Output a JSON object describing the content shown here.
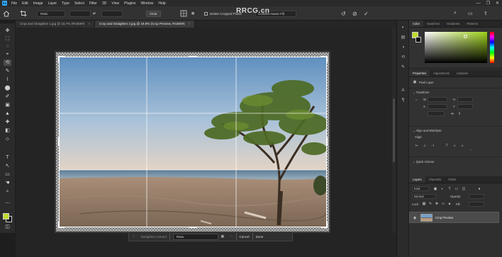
{
  "app": {
    "logo": "Ps",
    "menu": [
      "File",
      "Edit",
      "Image",
      "Layer",
      "Type",
      "Select",
      "Filter",
      "3D",
      "View",
      "Plugins",
      "Window",
      "Help"
    ],
    "window_controls": [
      "—",
      "❐",
      "✕"
    ]
  },
  "watermark": "RRCG.cn",
  "options_bar": {
    "ratio_select": "Ratio",
    "clear_label": "Clear",
    "delete_pixels_label": "Delete Cropped Pixels",
    "content_aware_label": "Content-Aware Fill",
    "accent_color": "#bddc2a"
  },
  "documents": {
    "tabs": [
      {
        "label": "Crop and Straighten 1.jpg @ 16.7% (RGB/8#)",
        "active": false
      },
      {
        "label": "Crop and Straighten 2.jpg @ 19.8% (Crop Preview, RGB/8#)",
        "active": true
      }
    ]
  },
  "crop_bar": {
    "straighten_label": "Straighten Control",
    "ratio_label": "Ratio",
    "cancel_label": "Cancel",
    "done_label": "Done"
  },
  "panels": {
    "top_tabs": [
      "Color",
      "Swatches",
      "Gradients",
      "Patterns"
    ],
    "properties_tabs": [
      "Properties",
      "Adjustments",
      "Libraries"
    ],
    "properties": {
      "doc_label": "Pixel Layer",
      "transform_label": "Transform",
      "w_label": "W",
      "h_label": "H",
      "x_label": "X",
      "y_label": "Y",
      "align_label": "Align and Distribute",
      "align_sub": "Align:",
      "quick_actions_label": "Quick Actions"
    },
    "layers_tabs": [
      "Layers",
      "Channels",
      "Paths"
    ],
    "layers": {
      "kind_label": "Kind",
      "mode_label": "Normal",
      "opacity_label": "Opacity:",
      "lock_label": "Lock:",
      "fill_label": "Fill:",
      "layer_name": "Crop Preview"
    }
  },
  "toolbar": {
    "tools": [
      "✥",
      "⬚",
      "◌",
      "⌖",
      "⟲",
      "✎",
      "⌇",
      "⬤",
      "✐",
      "▣",
      "▲",
      "✚",
      "◧",
      "⬦",
      "T",
      "↖",
      "▭",
      "☚",
      "⌕"
    ],
    "active_index": 4,
    "foreground_color": "#bddc2a",
    "background_color": "#000000"
  }
}
